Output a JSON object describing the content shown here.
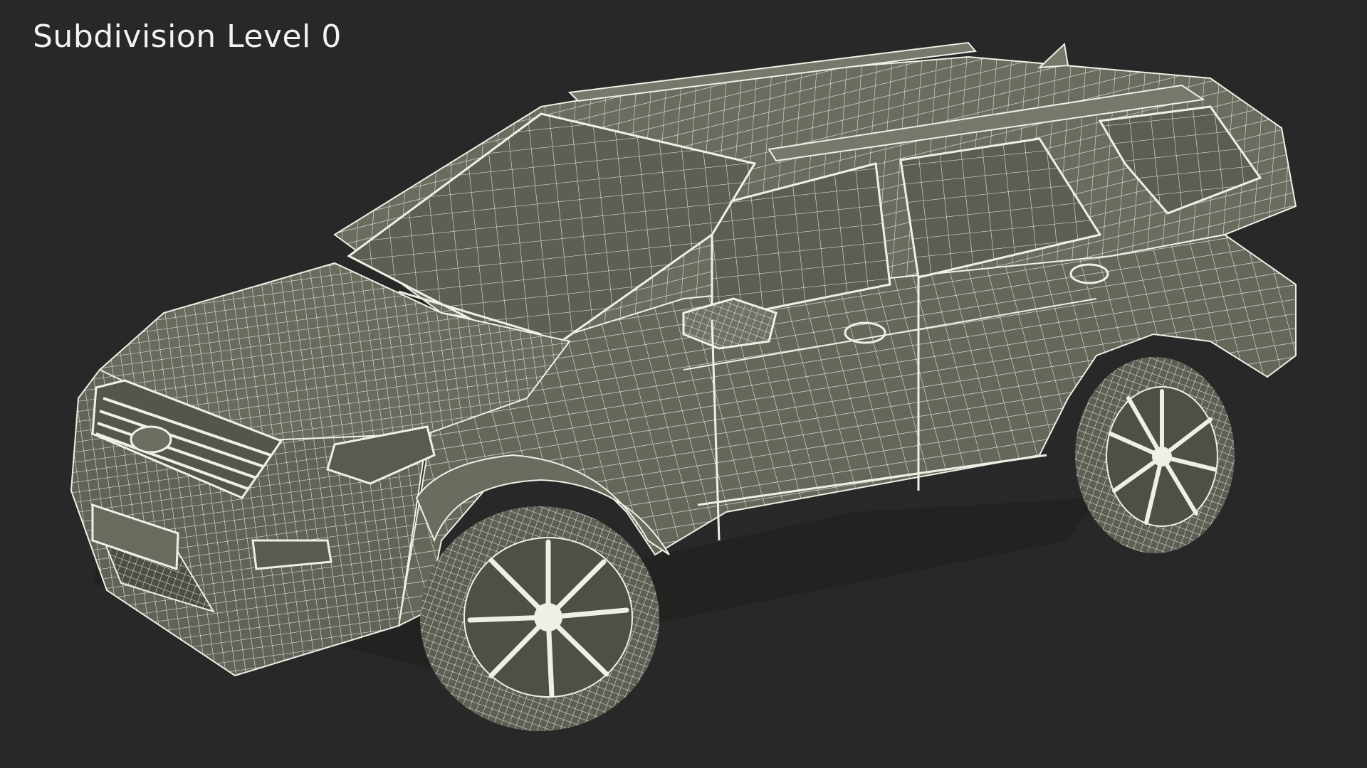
{
  "viewport": {
    "caption": "Subdivision Level 0",
    "background_color": "#282828",
    "mesh_fill_color": "#66665b",
    "wire_color": "#efefe6"
  },
  "model": {
    "icon": "suv-wireframe-render"
  }
}
